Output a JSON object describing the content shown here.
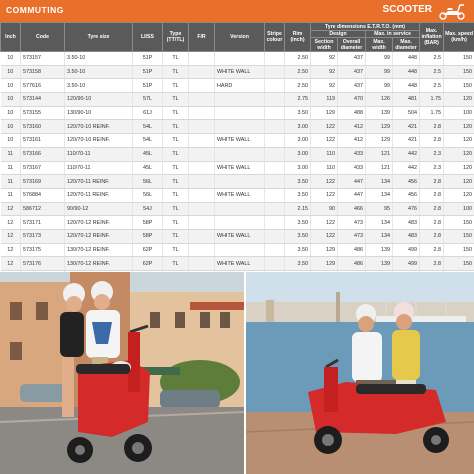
{
  "header": {
    "title": "COMMUTING",
    "section": "SCOOTER"
  },
  "table": {
    "col_inch": "Inch",
    "col_code": "Code",
    "col_size": "Tyre size",
    "col_liss": "LI/SS",
    "col_type": "Type (TT/TL)",
    "col_fr": "F/R",
    "col_version": "Version",
    "col_stripe": "Stripe colour",
    "col_rim": "Rim (inch)",
    "group_dims": "Tyre dimensions E.T.R.T.O. (mm)",
    "group_design": "Design",
    "group_service": "Max. in service",
    "col_section": "Section width",
    "col_overall": "Overall diameter",
    "col_maxw": "Max. width",
    "col_maxd": "Max. diameter",
    "col_infl": "Max. inflation (BAR)",
    "col_speed": "Max. speed (km/h)",
    "rows": [
      [
        "10",
        "573157",
        "3.50-10",
        "51P",
        "TL",
        "",
        "",
        "",
        "2.50",
        "92",
        "437",
        "99",
        "448",
        "2.5",
        "150"
      ],
      [
        "10",
        "573158",
        "3.50-10",
        "51P",
        "TL",
        "",
        "WHITE WALL",
        "",
        "2.50",
        "92",
        "437",
        "99",
        "448",
        "2.5",
        "150"
      ],
      [
        "10",
        "577616",
        "3.50-10",
        "51P",
        "TL",
        "",
        "HARD",
        "",
        "2.50",
        "92",
        "437",
        "99",
        "448",
        "2.5",
        "150"
      ],
      [
        "10",
        "573144",
        "120/90-10",
        "57L",
        "TL",
        "",
        "",
        "",
        "2.75",
        "119",
        "470",
        "126",
        "481",
        "1.75",
        "120"
      ],
      [
        "10",
        "573155",
        "130/90-10",
        "61J",
        "TL",
        "",
        "",
        "",
        "3.50",
        "129",
        "488",
        "139",
        "504",
        "1.75",
        "100"
      ],
      [
        "10",
        "573160",
        "120/70-10 REINF.",
        "54L",
        "TL",
        "",
        "",
        "",
        "3.00",
        "122",
        "412",
        "129",
        "421",
        "2.8",
        "120"
      ],
      [
        "10",
        "573161",
        "120/70-10 REINF.",
        "54L",
        "TL",
        "",
        "WHITE WALL",
        "",
        "3.00",
        "122",
        "412",
        "129",
        "421",
        "2.8",
        "120"
      ],
      [
        "11",
        "573166",
        "110/70-11",
        "45L",
        "TL",
        "",
        "",
        "",
        "3.00",
        "110",
        "433",
        "121",
        "442",
        "2.3",
        "120"
      ],
      [
        "11",
        "573167",
        "110/70-11",
        "45L",
        "TL",
        "",
        "WHITE WALL",
        "",
        "3.00",
        "110",
        "433",
        "121",
        "442",
        "2.3",
        "120"
      ],
      [
        "11",
        "573169",
        "120/70-11 REINF.",
        "56L",
        "TL",
        "",
        "",
        "",
        "3.50",
        "122",
        "447",
        "134",
        "456",
        "2.8",
        "120"
      ],
      [
        "11",
        "576884",
        "120/70-11 REINF.",
        "56L",
        "TL",
        "",
        "WHITE WALL",
        "",
        "3.50",
        "122",
        "447",
        "134",
        "456",
        "2.8",
        "120"
      ],
      [
        "12",
        "586712",
        "90/90-12",
        "54J",
        "TL",
        "",
        "",
        "",
        "2.15",
        "90",
        "466",
        "95",
        "476",
        "2.8",
        "100"
      ],
      [
        "12",
        "573171",
        "120/70-12 REINF.",
        "58P",
        "TL",
        "",
        "",
        "",
        "3.50",
        "122",
        "473",
        "134",
        "483",
        "2.8",
        "150"
      ],
      [
        "12",
        "573173",
        "120/70-12 REINF.",
        "58P",
        "TL",
        "",
        "WHITE WALL",
        "",
        "3.50",
        "122",
        "473",
        "134",
        "483",
        "2.8",
        "150"
      ],
      [
        "12",
        "573175",
        "130/70-12 REINF.",
        "62P",
        "TL",
        "",
        "",
        "",
        "3.50",
        "129",
        "486",
        "139",
        "499",
        "2.8",
        "150"
      ],
      [
        "12",
        "573176",
        "130/70-12 REINF.",
        "62P",
        "TL",
        "",
        "WHITE WALL",
        "",
        "3.50",
        "129",
        "486",
        "139",
        "499",
        "2.8",
        "150"
      ],
      [
        "13",
        "573178",
        "130/60-13 REINF.",
        "60P",
        "TL",
        "",
        "",
        "",
        "3.50",
        "129",
        "486",
        "139",
        "499",
        "2.8",
        "150"
      ]
    ]
  },
  "colors": {
    "accent": "#e8702a",
    "header_gray": "#5a5a5a",
    "scooter_red": "#d42a2a"
  },
  "icons": {
    "scooter": "scooter-icon"
  }
}
